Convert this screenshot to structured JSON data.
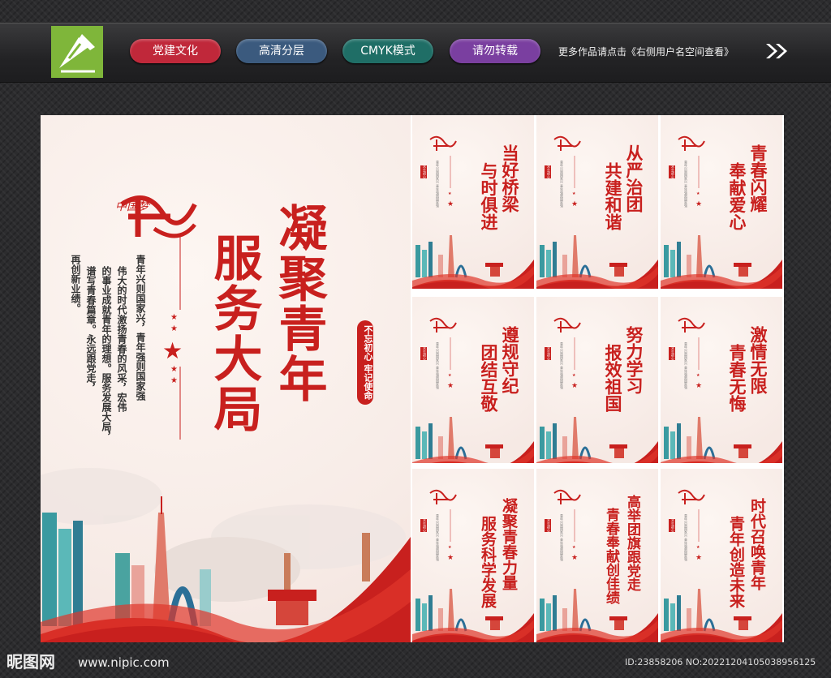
{
  "header": {
    "tags": [
      {
        "label": "党建文化",
        "color": "#c0283a"
      },
      {
        "label": "高清分层",
        "color": "#3b5a7e"
      },
      {
        "label": "CMYK模式",
        "color": "#1f6e66"
      },
      {
        "label": "请勿转载",
        "color": "#7a3fa0"
      }
    ],
    "promo": "更多作品请点击《右侧用户名空间查看》"
  },
  "main_poster": {
    "logo_text": "中国梦",
    "title_col1": "凝聚青年",
    "title_col2": "服务大局",
    "body_lines": [
      "青年兴则国家兴，青年强则国家强",
      "伟大的时代激扬青春的风采，宏伟",
      "的事业成就青年的理想。服务发展大局，",
      "谱写青春篇章。永远跟党走，",
      "再创新业绩。"
    ],
    "stamp": "不忘初心 牢记使命"
  },
  "panels": [
    {
      "title": [
        "当好桥梁",
        "与时俱进"
      ]
    },
    {
      "title": [
        "从严治团",
        "共建和谐"
      ]
    },
    {
      "title": [
        "青春闪耀",
        "奉献爱心"
      ]
    },
    {
      "title": [
        "遵规守纪",
        "团结互敬"
      ]
    },
    {
      "title": [
        "努力学习",
        "报效祖国"
      ]
    },
    {
      "title": [
        "激情无限",
        "青春无悔"
      ]
    },
    {
      "title": [
        "凝聚青春力量",
        "服务科学发展"
      ]
    },
    {
      "title": [
        "高举团旗跟党走",
        "青春奉献创佳绩"
      ]
    },
    {
      "title": [
        "时代召唤青年",
        "青年创造未来"
      ]
    }
  ],
  "panel_small_text": "青年兴则国家兴 青年强则国家强",
  "footer": {
    "site": "昵图网",
    "url": "www.nipic.com",
    "id": "ID:23858206 NO:20221204105038956125"
  },
  "colors": {
    "accent_red": "#c8201e",
    "background": "#2c2c2e",
    "logo_green": "#7fb63a"
  },
  "icons": [
    "pen-logo-icon",
    "double-arrow-icon",
    "star-icon",
    "red-ribbon",
    "city-skyline"
  ]
}
